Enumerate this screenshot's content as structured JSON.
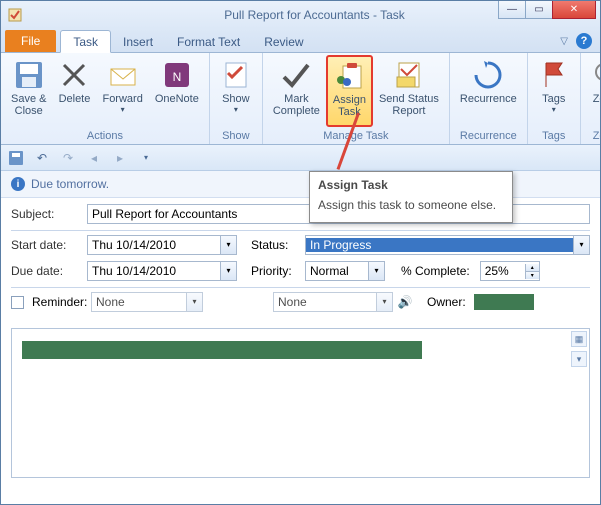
{
  "window": {
    "title": "Pull Report for Accountants  -  Task"
  },
  "tabs": {
    "file": "File",
    "task": "Task",
    "insert": "Insert",
    "format": "Format Text",
    "review": "Review"
  },
  "ribbon": {
    "actions": {
      "saveclose": "Save &\nClose",
      "delete": "Delete",
      "forward": "Forward",
      "onenote": "OneNote",
      "group": "Actions"
    },
    "show": {
      "show": "Show",
      "group": "Show"
    },
    "manage": {
      "markcomplete": "Mark\nComplete",
      "assigntask": "Assign\nTask",
      "sendstatus": "Send Status\nReport",
      "group": "Manage Task"
    },
    "recurrence": {
      "recurrence": "Recurrence",
      "group": "Recurrence"
    },
    "tags": {
      "tags": "Tags",
      "group": "Tags"
    },
    "zoom": {
      "zoom": "Zoom",
      "group": "Zoom"
    }
  },
  "notice": "Due tomorrow.",
  "form": {
    "subject_label": "Subject:",
    "subject_value": "Pull Report for Accountants",
    "start_label": "Start date:",
    "start_value": "Thu 10/14/2010",
    "due_label": "Due date:",
    "due_value": "Thu 10/14/2010",
    "status_label": "Status:",
    "status_value": "In Progress",
    "priority_label": "Priority:",
    "priority_value": "Normal",
    "pct_label": "% Complete:",
    "pct_value": "25%",
    "reminder_label": "Reminder:",
    "reminder_date": "None",
    "reminder_time": "None",
    "owner_label": "Owner:"
  },
  "tooltip": {
    "title": "Assign Task",
    "body": "Assign this task to someone else."
  }
}
